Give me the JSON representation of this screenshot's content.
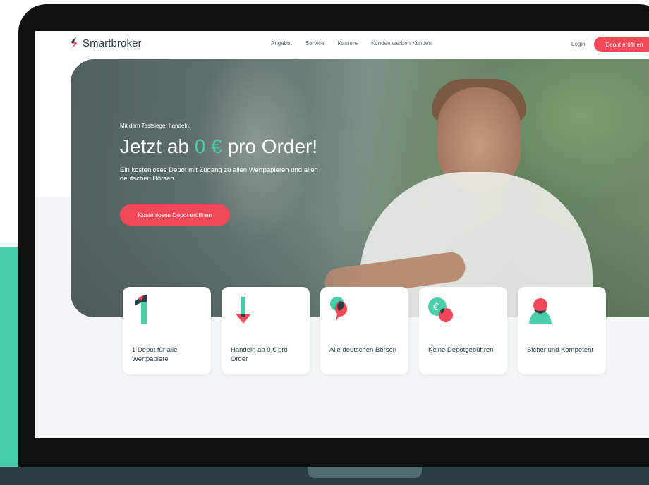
{
  "brand": {
    "name": "Smartbroker",
    "colors": {
      "teal": "#48cfa9",
      "red": "#f04856",
      "dark": "#2a3e45"
    }
  },
  "nav": {
    "links": [
      "Angebot",
      "Service",
      "Karriere",
      "Kunden werben Kunden"
    ],
    "login": "Login",
    "cta": "Depot eröffnen"
  },
  "hero": {
    "eyebrow": "Mit dem Testsieger handeln:",
    "title_prefix": "Jetzt ab",
    "title_accent": "0 €",
    "title_suffix": "pro Order!",
    "subtitle": "Ein kostenloses Depot mit Zugang zu allen Wertpapieren und allen deutschen Börsen.",
    "cta": "Kostenloses Depot eröffnen"
  },
  "features": [
    {
      "icon": "number-one-icon",
      "label": "1 Depot für alle Wertpapiere"
    },
    {
      "icon": "arrow-down-icon",
      "label": "Handeln ab 0 € pro Order"
    },
    {
      "icon": "speech-bubble-icon",
      "label": "Alle deutschen Börsen"
    },
    {
      "icon": "euro-coin-icon",
      "label": "Keine Depotgebühren"
    },
    {
      "icon": "person-icon",
      "label": "Sicher und Kompetent"
    }
  ]
}
